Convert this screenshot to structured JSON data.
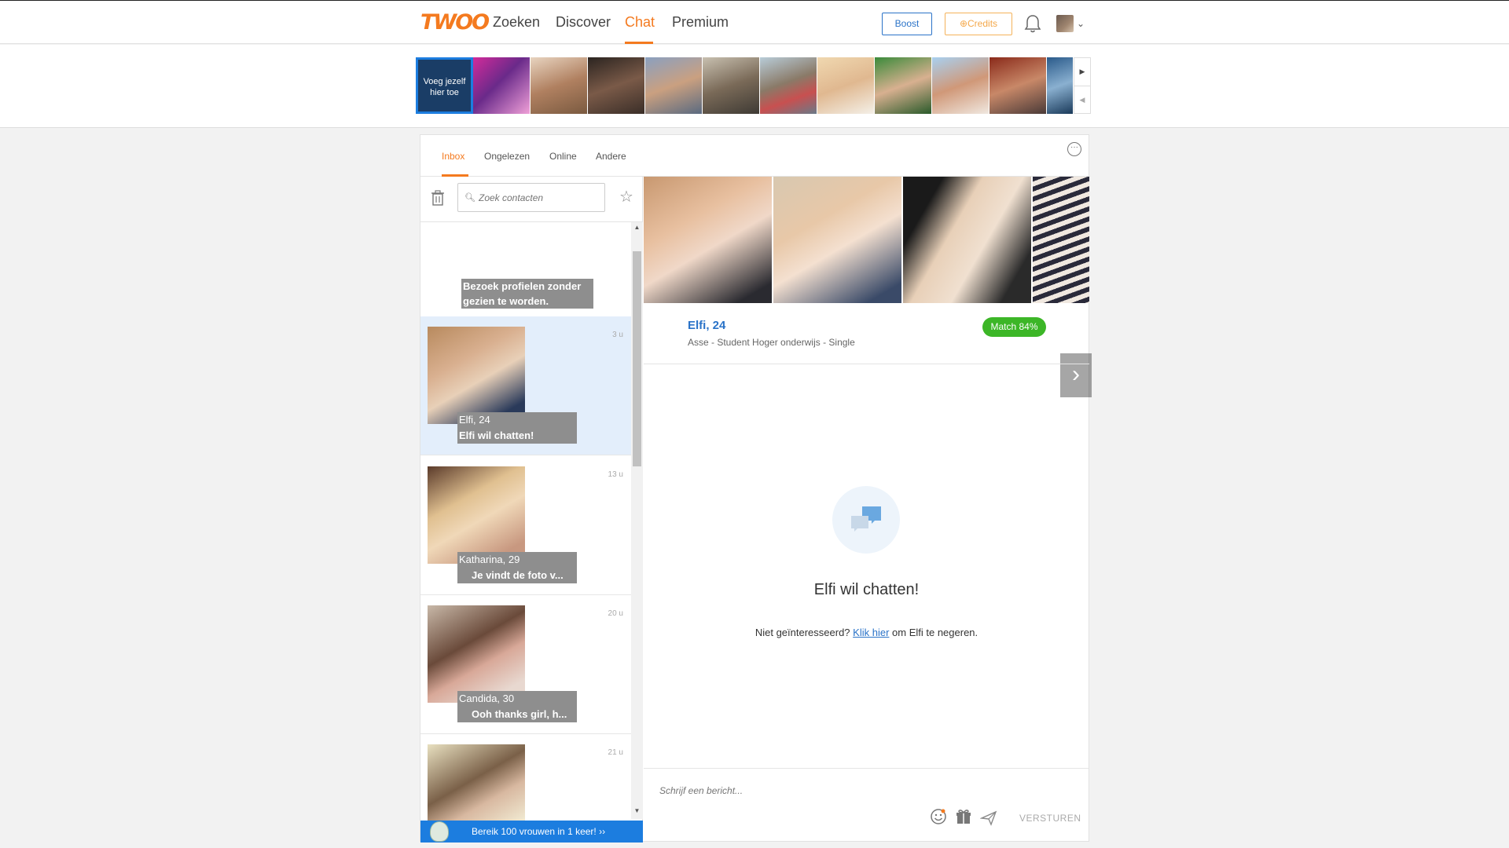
{
  "nav": {
    "logo": "TWOO",
    "links": [
      "Zoeken",
      "Discover",
      "Chat",
      "Premium"
    ],
    "boost": "Boost",
    "credits": "Credits",
    "accent": "#f47a1f"
  },
  "strip": {
    "add_self": "Voeg jezelf hier toe"
  },
  "tabs": [
    "Inbox",
    "Ongelezen",
    "Online",
    "Andere"
  ],
  "search": {
    "placeholder": "Zoek contacten"
  },
  "promo": {
    "text": "Bezoek profielen zonder gezien te worden."
  },
  "contacts": [
    {
      "name": "Elfi, 24",
      "message": "Elfi wil chatten!",
      "time": "3 u"
    },
    {
      "name": "Katharina, 29",
      "message": "Je vindt de foto v...",
      "time": "13 u"
    },
    {
      "name": "Candida, 30",
      "message": "Ooh thanks girl, h...",
      "time": "20 u"
    },
    {
      "name": "",
      "message": "",
      "time": "21 u"
    }
  ],
  "reach": {
    "text": "Bereik 100 vrouwen in 1 keer!  ››"
  },
  "profile": {
    "name": "Elfi, 24",
    "details": "Asse - Student Hoger onderwijs - Single",
    "match": "Match 84%"
  },
  "chat": {
    "title": "Elfi wil chatten!",
    "sub_before": "Niet geïnteresseerd?",
    "sub_link": "Klik hier",
    "sub_after": "om Elfi te negeren.",
    "compose_placeholder": "Schrijf een bericht...",
    "send": "VERSTUREN"
  }
}
